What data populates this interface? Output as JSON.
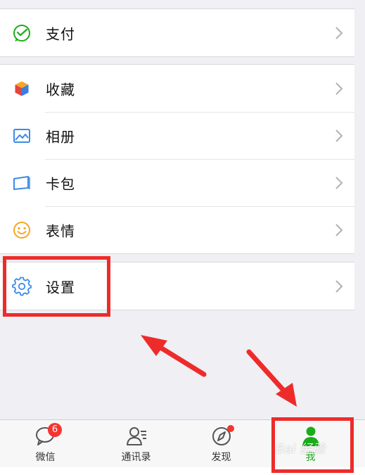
{
  "menu": {
    "pay": {
      "label": "支付",
      "icon": "wallet-icon"
    },
    "favorites": {
      "label": "收藏",
      "icon": "cube-icon"
    },
    "album": {
      "label": "相册",
      "icon": "picture-icon"
    },
    "cards": {
      "label": "卡包",
      "icon": "card-icon"
    },
    "stickers": {
      "label": "表情",
      "icon": "smiley-icon"
    },
    "settings": {
      "label": "设置",
      "icon": "gear-icon"
    }
  },
  "tabbar": {
    "chats": {
      "label": "微信",
      "badge": "6",
      "icon": "chat-bubble-icon"
    },
    "contacts": {
      "label": "通讯录",
      "icon": "contacts-icon"
    },
    "discover": {
      "label": "发现",
      "icon": "compass-icon"
    },
    "me": {
      "label": "我",
      "icon": "person-icon"
    }
  },
  "watermark": {
    "text": "Bai 经验"
  },
  "colors": {
    "brand_green": "#1aad19",
    "annotation_red": "#ee2b2b",
    "badge_red": "#f43530",
    "background": "#efeff4"
  }
}
